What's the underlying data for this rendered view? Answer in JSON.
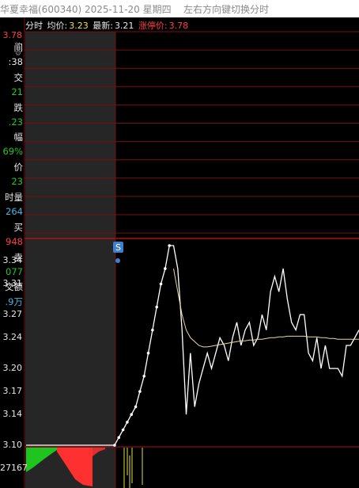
{
  "titlebar": {
    "stock": "华夏幸福(600340)",
    "date": "2025-11-20",
    "weekday": "星期四",
    "hint": "左右方向键切换分时"
  },
  "info": {
    "label": "分时",
    "avg_label": "均价:",
    "avg_value": "3.23",
    "latest_label": "最新:",
    "latest_value": "3.21",
    "limit_label": "涨停价:",
    "limit_value": "3.78"
  },
  "side_panel": [
    {
      "text": "间",
      "color": "#e6e6e6"
    },
    {
      "text": ":38",
      "color": "#e6e6e6"
    },
    {
      "text": "交",
      "color": "#e6e6e6"
    },
    {
      "text": "21",
      "color": "#23c923"
    },
    {
      "text": "跌",
      "color": "#e6e6e6"
    },
    {
      "text": ".23",
      "color": "#23c923"
    },
    {
      "text": "幅",
      "color": "#e6e6e6"
    },
    {
      "text": "69%",
      "color": "#23c923"
    },
    {
      "text": "价",
      "color": "#e6e6e6"
    },
    {
      "text": "23",
      "color": "#23c923"
    },
    {
      "text": "时量",
      "color": "#e6e6e6"
    },
    {
      "text": "264",
      "color": "#3fb7e6"
    },
    {
      "text": "买",
      "color": "#e6e6e6"
    },
    {
      "text": "948",
      "color": "#ff4040"
    },
    {
      "text": "卖",
      "color": "#e6e6e6"
    },
    {
      "text": "077",
      "color": "#23c923"
    },
    {
      "text": "交额",
      "color": "#e6e6e6"
    },
    {
      "text": ".9万",
      "color": "#3fb7e6"
    }
  ],
  "icons": {
    "close": "close-icon",
    "settings": "gear-icon",
    "marker": "S"
  },
  "price_axis": {
    "top_label": "3.78",
    "ticks": [
      "3.34",
      "3.31",
      "3.27",
      "3.24",
      "3.20",
      "3.17",
      "3.14",
      "3.10"
    ]
  },
  "volume_axis": {
    "label": "27167"
  },
  "colors": {
    "grid": "#7a0e0e",
    "up": "#ff3030",
    "down": "#1fc51f",
    "price": "#ffffff",
    "avg": "#e8d8a0",
    "accent": "#3f7fd0"
  },
  "chart_data": {
    "type": "line",
    "title": "",
    "y_range": [
      3.1,
      3.36
    ],
    "series": [
      {
        "name": "最新",
        "values": [
          3.1,
          3.1,
          3.1,
          3.1,
          3.1,
          3.1,
          3.1,
          3.1,
          3.1,
          3.1,
          3.1,
          3.1,
          3.1,
          3.1,
          3.1,
          3.1,
          3.1,
          3.1,
          3.1,
          3.1,
          3.1,
          3.1,
          3.11,
          3.12,
          3.13,
          3.14,
          3.15,
          3.17,
          3.19,
          3.22,
          3.25,
          3.28,
          3.31,
          3.33,
          3.36,
          3.36,
          3.33,
          3.25,
          3.14,
          3.22,
          3.15,
          3.18,
          3.2,
          3.22,
          3.2,
          3.22,
          3.24,
          3.23,
          3.21,
          3.24,
          3.26,
          3.23,
          3.25,
          3.26,
          3.23,
          3.24,
          3.27,
          3.25,
          3.3,
          3.32,
          3.3,
          3.33,
          3.29,
          3.26,
          3.25,
          3.27,
          3.27,
          3.22,
          3.21,
          3.24,
          3.2,
          3.23,
          3.2,
          3.2,
          3.2,
          3.19,
          3.23,
          3.23,
          3.24,
          3.25
        ]
      },
      {
        "name": "均价",
        "values": [
          null,
          null,
          null,
          null,
          null,
          null,
          null,
          null,
          null,
          null,
          null,
          null,
          null,
          null,
          null,
          null,
          null,
          null,
          null,
          null,
          null,
          null,
          null,
          null,
          null,
          null,
          null,
          null,
          null,
          null,
          null,
          null,
          null,
          null,
          null,
          3.33,
          3.3,
          3.27,
          3.25,
          3.24,
          3.235,
          3.23,
          3.228,
          3.228,
          3.229,
          3.23,
          3.231,
          3.232,
          3.233,
          3.234,
          3.235,
          3.236,
          3.236,
          3.237,
          3.237,
          3.238,
          3.238,
          3.239,
          3.24,
          3.24,
          3.241,
          3.241,
          3.242,
          3.242,
          3.242,
          3.242,
          3.242,
          3.241,
          3.241,
          3.241,
          3.24,
          3.24,
          3.239,
          3.239,
          3.238,
          3.238,
          3.238,
          3.238,
          3.238,
          3.238
        ]
      }
    ]
  }
}
